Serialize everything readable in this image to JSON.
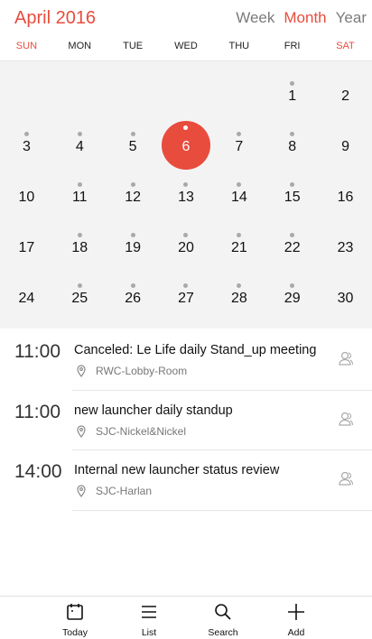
{
  "header": {
    "title": "April 2016",
    "views": [
      "Week",
      "Month",
      "Year"
    ],
    "active_view": "Month"
  },
  "weekdays": [
    "SUN",
    "MON",
    "TUE",
    "WED",
    "THU",
    "FRI",
    "SAT"
  ],
  "calendar": {
    "selected_day": "6",
    "days": [
      {
        "n": "1",
        "dot": true
      },
      {
        "n": "2",
        "dot": false
      },
      {
        "n": "3",
        "dot": true
      },
      {
        "n": "4",
        "dot": true
      },
      {
        "n": "5",
        "dot": true
      },
      {
        "n": "6",
        "dot": true
      },
      {
        "n": "7",
        "dot": true
      },
      {
        "n": "8",
        "dot": true
      },
      {
        "n": "9",
        "dot": false
      },
      {
        "n": "10",
        "dot": false
      },
      {
        "n": "11",
        "dot": true
      },
      {
        "n": "12",
        "dot": true
      },
      {
        "n": "13",
        "dot": true
      },
      {
        "n": "14",
        "dot": true
      },
      {
        "n": "15",
        "dot": true
      },
      {
        "n": "16",
        "dot": false
      },
      {
        "n": "17",
        "dot": false
      },
      {
        "n": "18",
        "dot": true
      },
      {
        "n": "19",
        "dot": true
      },
      {
        "n": "20",
        "dot": true
      },
      {
        "n": "21",
        "dot": true
      },
      {
        "n": "22",
        "dot": true
      },
      {
        "n": "23",
        "dot": false
      },
      {
        "n": "24",
        "dot": false
      },
      {
        "n": "25",
        "dot": true
      },
      {
        "n": "26",
        "dot": true
      },
      {
        "n": "27",
        "dot": true
      },
      {
        "n": "28",
        "dot": true
      },
      {
        "n": "29",
        "dot": true
      },
      {
        "n": "30",
        "dot": false
      }
    ],
    "first_weekday_index": 5
  },
  "events": [
    {
      "time": "11:00",
      "title": "Canceled: Le Life daily Stand_up meeting",
      "location": "RWC-Lobby-Room",
      "icon": "person-icon"
    },
    {
      "time": "11:00",
      "title": "new launcher daily standup",
      "location": "SJC-Nickel&Nickel",
      "icon": "person-icon"
    },
    {
      "time": "14:00",
      "title": "Internal new launcher status review",
      "location": "SJC-Harlan",
      "icon": "person-icon"
    }
  ],
  "bottom_nav": {
    "today": "Today",
    "list": "List",
    "search": "Search",
    "add": "Add"
  },
  "colors": {
    "accent": "#e84c3d",
    "grid_bg": "#f4f3f3"
  }
}
